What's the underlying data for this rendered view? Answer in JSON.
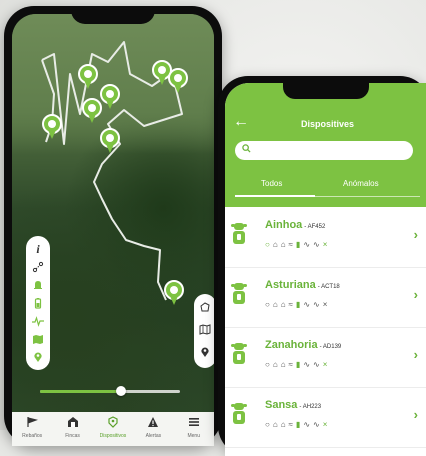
{
  "map_screen": {
    "map_controls_left": [
      "info-icon",
      "route-icon",
      "bell-icon",
      "battery-icon",
      "activity-icon",
      "map-layers-icon",
      "location-pin-icon"
    ],
    "map_controls_right": [
      "polygon-icon",
      "map-icon",
      "location-pin-icon"
    ],
    "timeline_progress": 0.58,
    "bottom_nav": [
      {
        "label": "Rebaños",
        "icon": "flag-icon",
        "active": false
      },
      {
        "label": "Fincas",
        "icon": "barn-icon",
        "active": false
      },
      {
        "label": "Dispositivos",
        "icon": "tag-icon",
        "active": true
      },
      {
        "label": "Alertas",
        "icon": "warning-icon",
        "active": false
      },
      {
        "label": "Menu",
        "icon": "menu-icon",
        "active": false
      }
    ]
  },
  "devices_screen": {
    "title": "Dispositives",
    "search": {
      "placeholder": ""
    },
    "tabs": [
      {
        "label": "Todos",
        "active": true
      },
      {
        "label": "Anómalos",
        "active": false
      }
    ],
    "devices": [
      {
        "name": "Ainhoa",
        "code": "- AF452"
      },
      {
        "name": "Asturiana",
        "code": "- ACT18"
      },
      {
        "name": "Zanahoria",
        "code": "- AD139"
      },
      {
        "name": "Sansa",
        "code": "- AH223"
      }
    ]
  },
  "colors": {
    "accent": "#7dc242",
    "accent_dark": "#6ab33a",
    "frame": "#0c0c0c"
  }
}
